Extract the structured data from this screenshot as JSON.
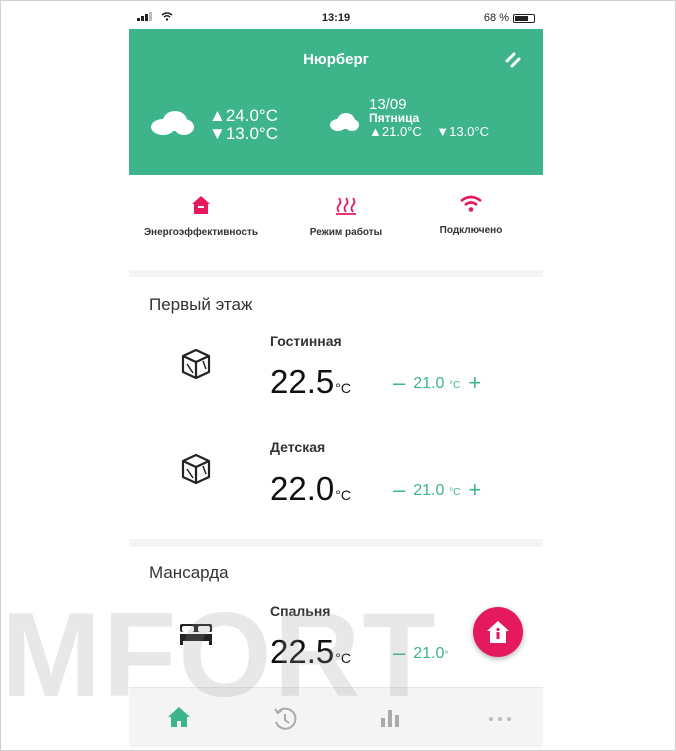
{
  "status_bar": {
    "time": "13:19",
    "battery": "68 %"
  },
  "header": {
    "city": "Нюрберг",
    "today": {
      "high": "▲24.0°C",
      "low": "▼13.0°C"
    },
    "forecast": {
      "date": "13/09",
      "day": "Пятница",
      "high": "▲21.0°C",
      "low": "▼13.0°C"
    }
  },
  "modes": [
    {
      "label": "Энергоэффективность",
      "icon": "house-icon"
    },
    {
      "label": "Режим работы",
      "icon": "heat-waves-icon"
    },
    {
      "label": "Подключено",
      "icon": "wifi-icon"
    }
  ],
  "floors": [
    {
      "title": "Первый этаж",
      "rooms": [
        {
          "name": "Гостинная",
          "temp": "22.5",
          "unit": "°C",
          "setpoint": "21.0",
          "sp_unit": "°C"
        },
        {
          "name": "Детская",
          "temp": "22.0",
          "unit": "°C",
          "setpoint": "21.0",
          "sp_unit": "°C"
        }
      ]
    },
    {
      "title": "Мансарда",
      "rooms": [
        {
          "name": "Спальня",
          "temp": "22.5",
          "unit": "°C",
          "setpoint": "21.0",
          "sp_unit": "°"
        }
      ]
    }
  ],
  "controls": {
    "minus": "–",
    "plus": "+"
  },
  "watermark": "MFORT",
  "bottom_nav": [
    "home-icon",
    "history-icon",
    "statistics-icon",
    "more-icon"
  ],
  "colors": {
    "accent": "#3db48a",
    "brand": "#e5195f"
  }
}
